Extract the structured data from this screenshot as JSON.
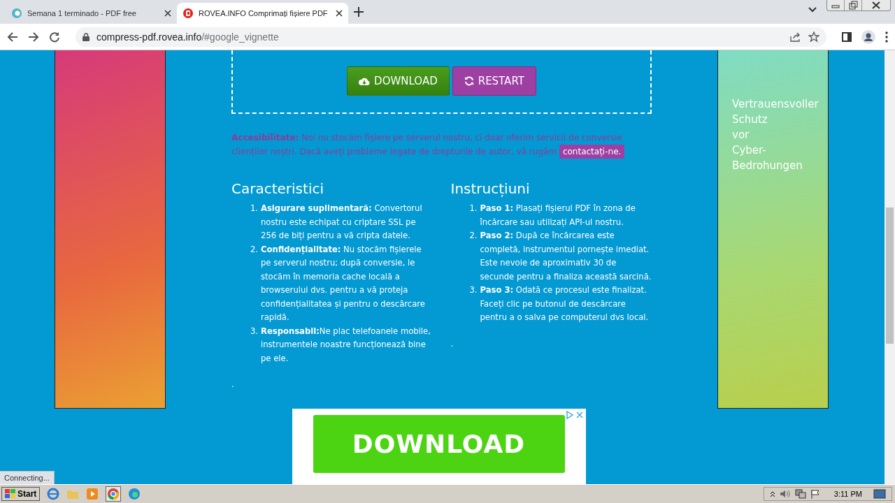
{
  "browser": {
    "tabs": [
      {
        "title": "Semana 1 terminado - PDF free",
        "selected": false
      },
      {
        "title": "ROVEA.INFO Comprimați fișiere PDF",
        "selected": true
      }
    ],
    "address": {
      "host": "compress-pdf.rovea.info",
      "path": "/#google_vignette"
    }
  },
  "actions": [
    {
      "label": "DOWNLOAD",
      "kind": "download"
    },
    {
      "label": "RESTART",
      "kind": "restart"
    }
  ],
  "notice": {
    "label": "Accesibilitate:",
    "text": "Noi nu stocăm fișiere pe serverul nostru, ci doar oferim servicii de conversie clienților noștri. Dacă aveți probleme legate de drepturile de autor, vă rugăm",
    "link": "contactați-ne."
  },
  "sections": [
    {
      "heading": "Caracteristici",
      "items": [
        {
          "marker": "1.",
          "label": "Asigurare suplimentară:",
          "text": " Convertorul nostru este echipat cu criptare SSL pe 256 de biți pentru a vă cripta datele."
        },
        {
          "marker": "2.",
          "label": "Confidențialitate:",
          "text": " Nu stocăm fișierele pe serverul nostru; după conversie, le stocăm în memoria cache locală a browserului dvs. pentru a vă proteja confidențialitatea și pentru o descărcare rapidă."
        },
        {
          "marker": "3.",
          "label": "Responsabil:",
          "text": "Ne plac telefoanele mobile, instrumentele noastre funcționează bine pe ele."
        }
      ],
      "trailing_mark": "."
    },
    {
      "heading": "Instrucțiuni",
      "items": [
        {
          "marker": "1.",
          "label": "Paso 1:",
          "text": " Plasați fișierul PDF în zona de încărcare sau utilizați API-ul nostru."
        },
        {
          "marker": "2.",
          "label": "Paso 2:",
          "text": " După ce încărcarea este completă, instrumentul pornește imediat. Este nevoie de aproximativ 30 de secunde pentru a finaliza această sarcină."
        },
        {
          "marker": "3.",
          "label": "Paso 3:",
          "text": " Odată ce procesul este finalizat. Faceți clic pe butonul de descărcare pentru a o salva pe computerul dvs local."
        }
      ],
      "trailing_mark": "."
    }
  ],
  "right_banner": {
    "lines": [
      "Vertrauensvoller",
      "Schutz",
      "vor",
      "Cyber-",
      "Bedrohungen"
    ]
  },
  "bottom_ad": {
    "button": "DOWNLOAD"
  },
  "status_bar": "Connecting...",
  "taskbar": {
    "start": "Start",
    "clock": "3:11 PM"
  }
}
